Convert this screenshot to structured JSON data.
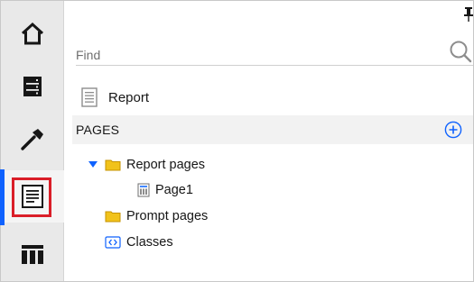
{
  "search": {
    "placeholder": "Find"
  },
  "rail": {
    "items": [
      {
        "icon": "home-icon"
      },
      {
        "icon": "data-server-icon"
      },
      {
        "icon": "hammer-icon"
      },
      {
        "icon": "report-pages-icon",
        "active": true
      },
      {
        "icon": "table-icon"
      }
    ]
  },
  "panel": {
    "report_label": "Report",
    "pages_header": "PAGES",
    "tree": [
      {
        "label": "Report pages",
        "expanded": true
      },
      {
        "label": "Page1"
      },
      {
        "label": "Prompt pages"
      },
      {
        "label": "Classes"
      }
    ]
  },
  "colors": {
    "accent": "#0f62fe",
    "highlight": "#da1e28",
    "folder": "#f1c21b",
    "rail_bg": "#e9e9e9"
  }
}
